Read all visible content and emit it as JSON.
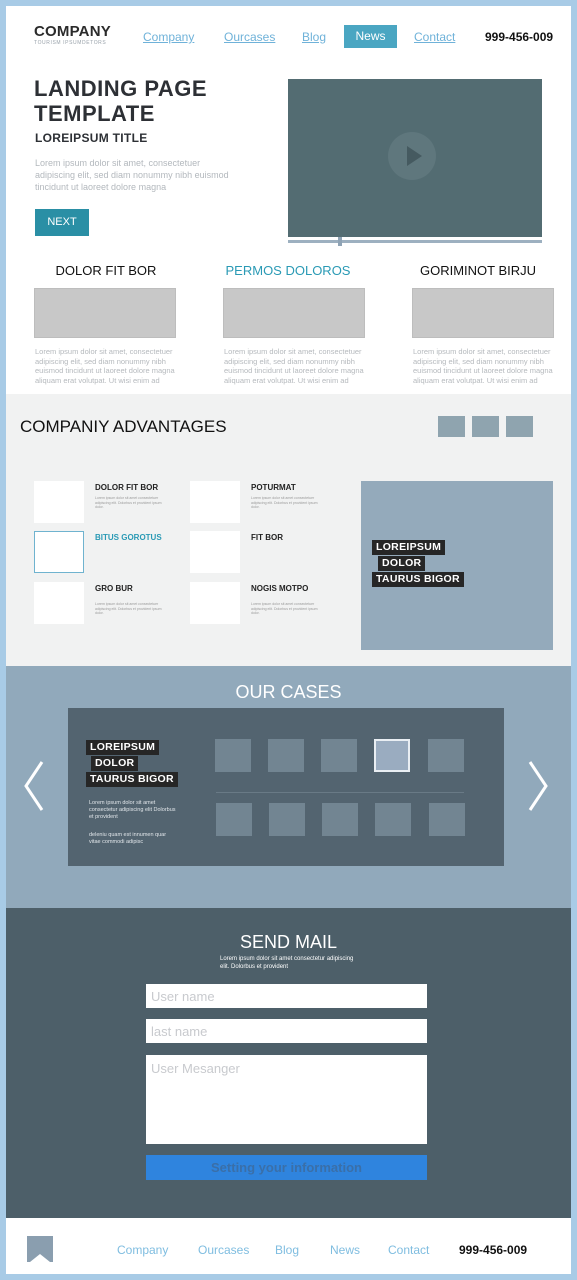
{
  "header": {
    "logo": "COMPANY",
    "logo_sub": "TOURISM IPSUMDETORS",
    "nav": [
      "Company",
      "Ourcases",
      "Blog",
      "News",
      "Contact"
    ],
    "active": "News",
    "phone": "999-456-009"
  },
  "hero": {
    "title_line1": "LANDING PAGE",
    "title_line2": "TEMPLATE",
    "subtitle": "LOREIPSUM TITLE",
    "text": "Lorem ipsum dolor sit amet, consectetuer adipiscing elit, sed diam nonummy nibh euismod tincidunt ut laoreet dolore magna",
    "button": "NEXT"
  },
  "features": [
    {
      "title": "DOLOR FIT BOR",
      "text": "Lorem ipsum dolor sit amet, consectetuer adipiscing elit, sed diam nonummy nibh euismod tincidunt ut laoreet dolore magna aliquam erat volutpat. Ut wisi enim ad"
    },
    {
      "title": "PERMOS DOLOROS",
      "text": "Lorem ipsum dolor sit amet, consectetuer adipiscing elit, sed diam nonummy nibh euismod tincidunt ut laoreet dolore magna aliquam erat volutpat. Ut wisi enim ad"
    },
    {
      "title": "GORIMINOT BIRJU",
      "text": "Lorem ipsum dolor sit amet, consectetuer adipiscing elit, sed diam nonummy nibh euismod tincidunt ut laoreet dolore magna aliquam erat volutpat. Ut wisi enim ad"
    }
  ],
  "advantages": {
    "title": "COMPANIY ADVANTAGES",
    "items": [
      {
        "title": "DOLOR FIT BOR",
        "text": "Lorem ipsum dolor sit amet consectetuer adipiscing elit. Dolorbus et provident ipsum dolor."
      },
      {
        "title": "POTURMAT",
        "text": "Lorem ipsum dolor sit amet consectetuer adipiscing elit. Dolorbus et provident ipsum dolor."
      },
      {
        "title": "BITUS GOROTUS",
        "text": ""
      },
      {
        "title": "FIT BOR",
        "text": ""
      },
      {
        "title": "GRO BUR",
        "text": "Lorem ipsum dolor sit amet consectetuer adipiscing elit. Dolorbus et provident ipsum dolor."
      },
      {
        "title": "NOGIS MOTPO",
        "text": "Lorem ipsum dolor sit amet consectetuer adipiscing elit. Dolorbus et provident ipsum dolor."
      }
    ],
    "tags": [
      "LOREIPSUM",
      "DOLOR",
      "TAURUS BIGOR"
    ]
  },
  "cases": {
    "title": "OUR CASES",
    "tags": [
      "LOREIPSUM",
      "DOLOR",
      "TAURUS BIGOR"
    ],
    "text1": "Lorem ipsum dolor sit amet consectetur adipiscing elit Dolorbus et provident",
    "text2": "deleniu quam est innumen quar vitae commodi adipisc"
  },
  "mail": {
    "title": "SEND MAIL",
    "subtitle": "Lorem ipsum dolor sit amet consectetur adipiscing elit. Dolorbus et provident",
    "name_placeholder": "User name",
    "last_placeholder": "last name",
    "message_placeholder": "User Mesanger",
    "button": "Setting your information"
  },
  "footer": {
    "nav": [
      "Company",
      "Ourcases",
      "Blog",
      "News",
      "Contact"
    ],
    "phone": "999-456-009"
  }
}
